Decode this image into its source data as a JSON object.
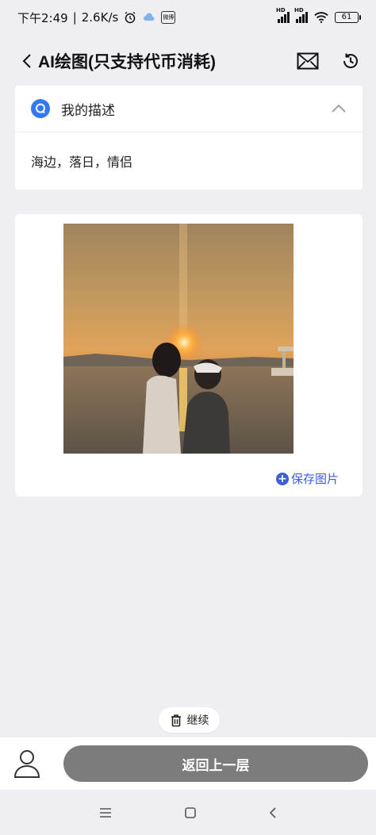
{
  "status_bar": {
    "time": "下午2:49",
    "separator": "|",
    "speed": "2.6K/s",
    "app_badge_text": "微博",
    "signal_label": "HD",
    "battery": "61"
  },
  "nav": {
    "title": "AI绘图(只支持代币消耗)",
    "icons": [
      "chevron-left-icon",
      "mail-icon",
      "history-icon"
    ]
  },
  "description": {
    "label": "我的描述",
    "text": "海边，落日，情侣",
    "icon": "q-chat-icon",
    "expanded": true
  },
  "image_card": {
    "save_label": "保存图片"
  },
  "continue_button": {
    "label": "继续"
  },
  "bottom": {
    "return_label": "返回上一层"
  },
  "colors": {
    "accent_blue": "#3b5fd6",
    "q_icon_blue": "#3478f6",
    "return_button_gray": "#7c7c7c",
    "page_background": "#eeeef3"
  }
}
